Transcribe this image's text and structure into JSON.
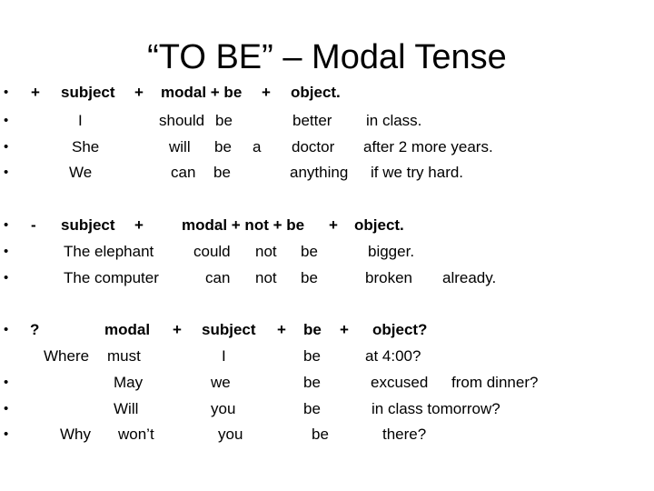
{
  "title": "“TO BE” – Modal Tense",
  "affirmative": {
    "header": {
      "sign": "+",
      "subject": "subject",
      "plus1": "+",
      "modal_be": "modal + be",
      "plus2": "+",
      "object": "object."
    },
    "rows": [
      {
        "subject": "I",
        "modal": "should",
        "be": "be",
        "article": "",
        "object": "better",
        "extra": "in class."
      },
      {
        "subject": "She",
        "modal": "will",
        "be": "be",
        "article": "a",
        "object": "doctor",
        "extra": "after 2 more years."
      },
      {
        "subject": "We",
        "modal": "can",
        "be": "be",
        "article": "",
        "object": "anything",
        "extra": "if we try hard."
      }
    ]
  },
  "negative": {
    "header": {
      "sign": "-",
      "subject": "subject",
      "plus1": "+",
      "modal_not_be": "modal + not + be",
      "plus2": "+",
      "object": "object."
    },
    "rows": [
      {
        "subject": "The elephant",
        "modal": "could",
        "not": "not",
        "be": "be",
        "object": "bigger.",
        "extra": ""
      },
      {
        "subject": "The computer",
        "modal": "can",
        "not": "not",
        "be": "be",
        "object": "broken",
        "extra": "already."
      }
    ]
  },
  "question": {
    "header": {
      "sign": "?",
      "modal": "modal",
      "plus1": "+",
      "subject": "subject",
      "plus2": "+",
      "be": "be",
      "plus3": "+",
      "object": "object?"
    },
    "rows": [
      {
        "wh": "Where",
        "modal": "must",
        "subject": "I",
        "be": "be",
        "object": "at 4:00?"
      },
      {
        "wh": "",
        "modal": "May",
        "subject": "we",
        "be": "be",
        "object": "excused",
        "extra": "from dinner?"
      },
      {
        "wh": "",
        "modal": "Will",
        "subject": "you",
        "be": "be",
        "object": "in class tomorrow?"
      },
      {
        "wh": "Why",
        "modal": "won’t",
        "subject": "you",
        "be": "be",
        "object": "there?"
      }
    ]
  },
  "bullet_glyph": "•"
}
